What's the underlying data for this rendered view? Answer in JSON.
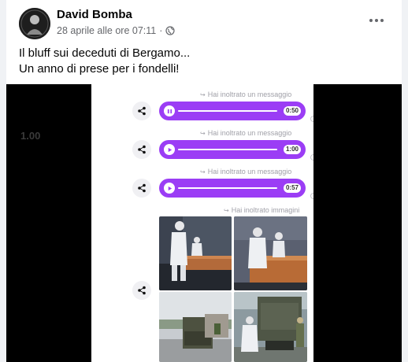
{
  "post": {
    "author": "David Bomba",
    "timestamp": "28 aprile alle ore 07:11",
    "separator": "·",
    "privacy_icon": "globe-icon",
    "text_line1": "Il bluff sui deceduti di Bergamo...",
    "text_line2": "Un anno di prese per i fondelli!"
  },
  "video": {
    "time": "1.00"
  },
  "chat": {
    "voice_messages": [
      {
        "forward_label": "Hai inoltrato un messaggio",
        "duration": "0:50",
        "state": "pause"
      },
      {
        "forward_label": "Hai inoltrato un messaggio",
        "duration": "1:00",
        "state": "play"
      },
      {
        "forward_label": "Hai inoltrato un messaggio",
        "duration": "0:57",
        "state": "play"
      }
    ],
    "images_label": "Hai inoltrato immagini"
  },
  "colors": {
    "bubble": "#9b3df5",
    "meta_text": "#65676b"
  }
}
